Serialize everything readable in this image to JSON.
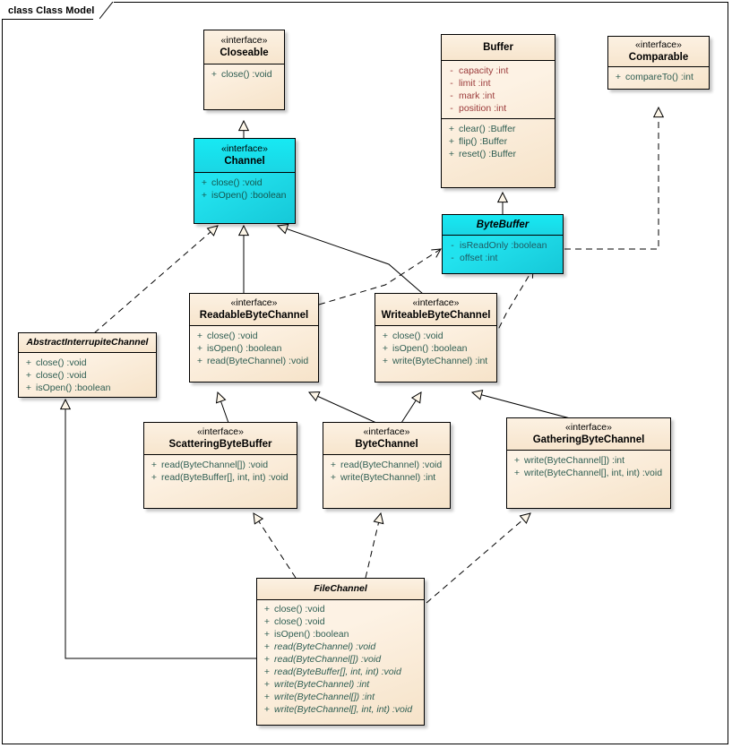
{
  "diagram": {
    "tab_label": "class Class Model",
    "background": "#ffffff",
    "frame_color": "#000000"
  },
  "palette": {
    "class_fill": "#fbeedd",
    "highlight_fill": "#1ae0ec",
    "border": "#000000",
    "member_text": "#2e5d52",
    "attribute_text": "#9b3a3a"
  },
  "nodes": {
    "closeable": {
      "stereotype": "«interface»",
      "name": "Closeable",
      "features": [
        {
          "vis": "+",
          "sig": "close()  :void"
        }
      ]
    },
    "buffer": {
      "stereotype": "",
      "name": "Buffer",
      "attributes": [
        {
          "vis": "-",
          "sig": "capacity  :int"
        },
        {
          "vis": "-",
          "sig": "limit  :int"
        },
        {
          "vis": "-",
          "sig": "mark  :int"
        },
        {
          "vis": "-",
          "sig": "position  :int"
        }
      ],
      "features": [
        {
          "vis": "+",
          "sig": "clear()  :Buffer"
        },
        {
          "vis": "+",
          "sig": "flip()  :Buffer"
        },
        {
          "vis": "+",
          "sig": "reset()  :Buffer"
        }
      ]
    },
    "comparable": {
      "stereotype": "«interface»",
      "name": "Comparable",
      "features": [
        {
          "vis": "+",
          "sig": "compareTo()  :int"
        }
      ]
    },
    "channel": {
      "stereotype": "«interface»",
      "name": "Channel",
      "features": [
        {
          "vis": "+",
          "sig": "close()  :void"
        },
        {
          "vis": "+",
          "sig": "isOpen()  :boolean"
        }
      ]
    },
    "bytebuffer": {
      "stereotype": "",
      "name": "ByteBuffer",
      "attributes": [
        {
          "vis": "-",
          "sig": "isReadOnly  :boolean"
        },
        {
          "vis": "-",
          "sig": "offset  :int"
        }
      ],
      "features": []
    },
    "readablebytechannel": {
      "stereotype": "«interface»",
      "name": "ReadableByteChannel",
      "features": [
        {
          "vis": "+",
          "sig": "close()  :void"
        },
        {
          "vis": "+",
          "sig": "isOpen()  :boolean"
        },
        {
          "vis": "+",
          "sig": "read(ByteChannel)  :void"
        }
      ]
    },
    "writeablebytechannel": {
      "stereotype": "«interface»",
      "name": "WriteableByteChannel",
      "features": [
        {
          "vis": "+",
          "sig": "close()  :void"
        },
        {
          "vis": "+",
          "sig": "isOpen()  :boolean"
        },
        {
          "vis": "+",
          "sig": "write(ByteChannel)  :int"
        }
      ]
    },
    "abstractinterrupitechannel": {
      "stereotype": "",
      "name": "AbstractInterrupiteChannel",
      "features": [
        {
          "vis": "+",
          "sig": "close()  :void"
        },
        {
          "vis": "+",
          "sig": "close()  :void"
        },
        {
          "vis": "+",
          "sig": "isOpen()  :boolean"
        }
      ]
    },
    "scatteringbytebuffer": {
      "stereotype": "«interface»",
      "name": "ScatteringByteBuffer",
      "features": [
        {
          "vis": "+",
          "sig": "read(ByteChannel[])  :void"
        },
        {
          "vis": "+",
          "sig": "read(ByteBuffer[], int, int)  :void"
        }
      ]
    },
    "bytechannel": {
      "stereotype": "«interface»",
      "name": "ByteChannel",
      "features": [
        {
          "vis": "+",
          "sig": "read(ByteChannel)  :void"
        },
        {
          "vis": "+",
          "sig": "write(ByteChannel)  :int"
        }
      ]
    },
    "gatheringbytechannel": {
      "stereotype": "«interface»",
      "name": "GatheringByteChannel",
      "features": [
        {
          "vis": "+",
          "sig": "write(ByteChannel[])  :int"
        },
        {
          "vis": "+",
          "sig": "write(ByteChannel[], int, int)  :void"
        }
      ]
    },
    "filechannel": {
      "stereotype": "",
      "name": "FileChannel",
      "features": [
        {
          "vis": "+",
          "sig": "close()  :void"
        },
        {
          "vis": "+",
          "sig": "close()  :void"
        },
        {
          "vis": "+",
          "sig": "isOpen()  :boolean"
        },
        {
          "vis": "+",
          "sig": "read(ByteChannel)  :void"
        },
        {
          "vis": "+",
          "sig": "read(ByteChannel[])  :void"
        },
        {
          "vis": "+",
          "sig": "read(ByteBuffer[], int, int)  :void"
        },
        {
          "vis": "+",
          "sig": "write(ByteChannel)  :int"
        },
        {
          "vis": "+",
          "sig": "write(ByteChannel[])  :int"
        },
        {
          "vis": "+",
          "sig": "write(ByteChannel[], int, int)  :void"
        }
      ]
    }
  }
}
